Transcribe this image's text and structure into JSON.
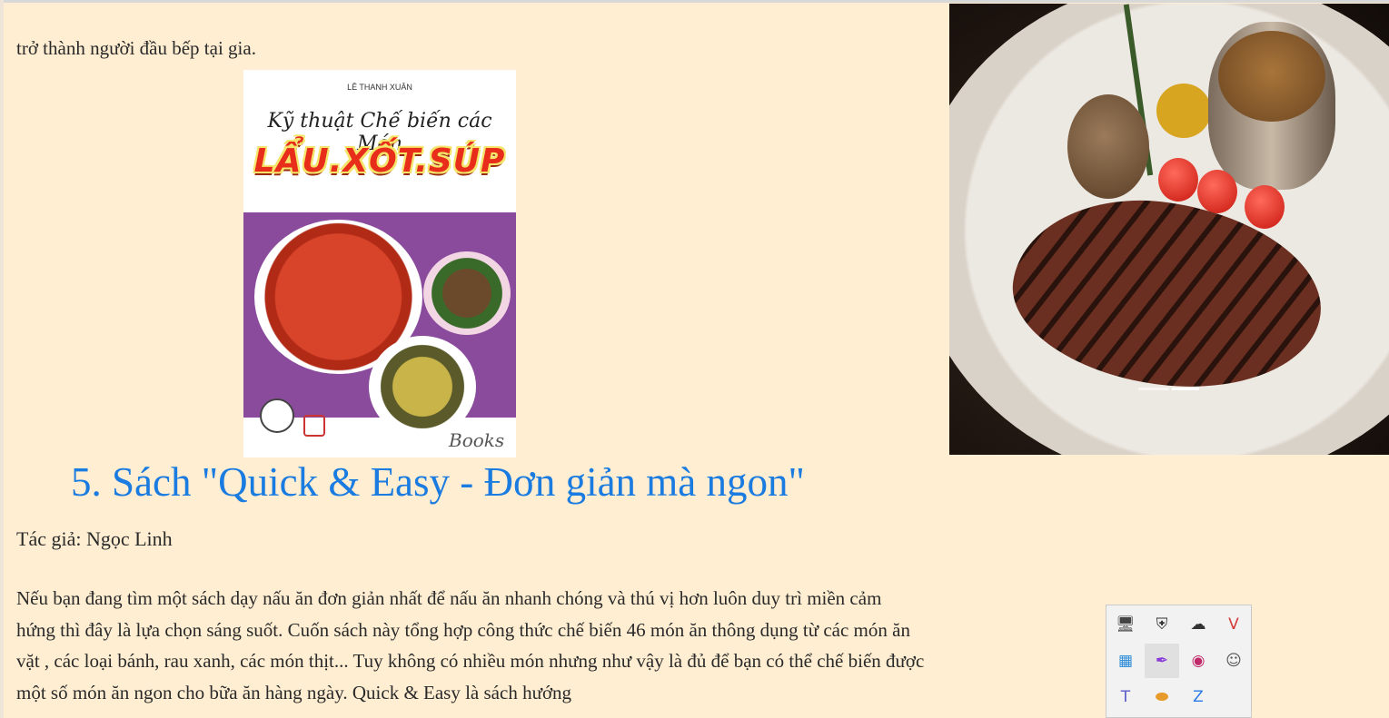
{
  "article": {
    "intro_tail": "trở thành người đầu bếp tại gia.",
    "book_cover": {
      "author": "LÊ THANH XUÂN",
      "subtitle": "Kỹ thuật Chế biến các Món",
      "title": "LẨU.XỐT.SÚP",
      "brand": "Books"
    },
    "section_heading": "5. Sách \"Quick & Easy - Đơn giản mà ngon\"",
    "author_line": "Tác giả: Ngọc Linh",
    "body_paragraph": "Nếu bạn đang tìm một sách dạy nấu ăn đơn giản nhất để nấu ăn nhanh chóng và thú vị hơn luôn duy trì miền cảm hứng thì đây là lựa chọn sáng suốt. Cuốn sách này tổng hợp công thức chế biến 46 món ăn thông dụng từ các món ăn vặt , các loại bánh, rau xanh, các món thịt... Tuy không có nhiều món nhưng như vậy là đủ để bạn có thể chế biến được một số món ăn ngon cho bữa ăn hàng ngày. Quick & Easy là sách hướng"
  },
  "carousel": {
    "active_index": 2,
    "slide_count": 2
  },
  "tray_icons": [
    {
      "name": "monitor-icon",
      "glyph": "🖥",
      "color": "#444444"
    },
    {
      "name": "security-shield-icon",
      "glyph": "⛨",
      "color": "#333333"
    },
    {
      "name": "cloud-offline-icon",
      "glyph": "☁",
      "color": "#333333"
    },
    {
      "name": "vivaldi-icon",
      "glyph": "V",
      "color": "#d43a3a"
    },
    {
      "name": "app-window-icon",
      "glyph": "▦",
      "color": "#2a8ad8"
    },
    {
      "name": "feather-pen-icon",
      "glyph": "✒",
      "color": "#8a3ad8"
    },
    {
      "name": "media-app-icon",
      "glyph": "◉",
      "color": "#c02a6a"
    },
    {
      "name": "discord-icon",
      "glyph": "☺",
      "color": "#555555"
    },
    {
      "name": "teams-icon",
      "glyph": "T",
      "color": "#5a5ac8"
    },
    {
      "name": "storage-drive-icon",
      "glyph": "⬬",
      "color": "#e89a2a"
    },
    {
      "name": "zalo-icon",
      "glyph": "Z",
      "color": "#2a7ae8"
    }
  ]
}
